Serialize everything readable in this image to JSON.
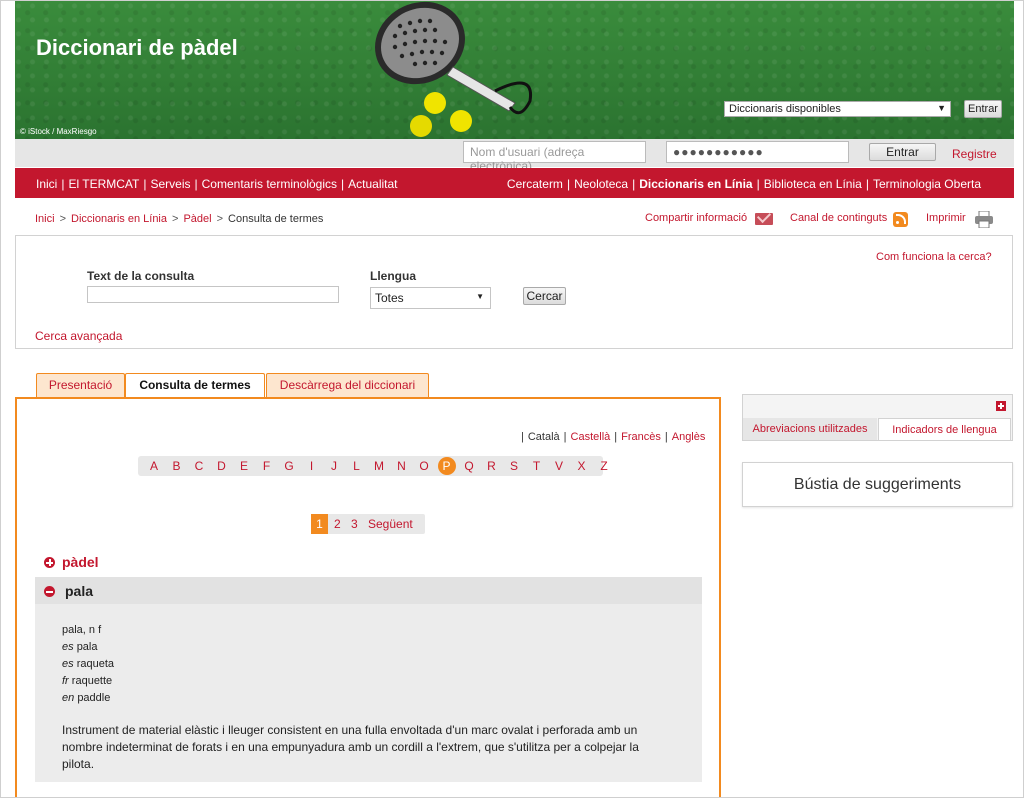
{
  "banner": {
    "title": "Diccionari de pàdel",
    "credit": "© iStock / MaxRiesgo",
    "dictionaries_select": "Diccionaris disponibles",
    "enter_button": "Entrar"
  },
  "login": {
    "user_placeholder": "Nom d'usuari (adreça electrònica)",
    "password_value": "●●●●●●●●●●●",
    "enter_button": "Entrar",
    "register_link": "Registre"
  },
  "nav": {
    "left": [
      "Inici",
      "El TERMCAT",
      "Serveis",
      "Comentaris terminològics",
      "Actualitat"
    ],
    "right": [
      "Cercaterm",
      "Neoloteca",
      "Diccionaris en Línia",
      "Biblioteca en Línia",
      "Terminologia Oberta"
    ]
  },
  "breadcrumb": [
    "Inici",
    "Diccionaris en Línia",
    "Pàdel",
    "Consulta de termes"
  ],
  "tools": {
    "share": "Compartir informació",
    "feed": "Canal de continguts",
    "print": "Imprimir"
  },
  "search": {
    "help_link": "Com funciona la cerca?",
    "query_label": "Text de la consulta",
    "language_label": "Llengua",
    "language_value": "Totes",
    "search_button": "Cercar",
    "advanced_link": "Cerca avançada"
  },
  "tabs": [
    "Presentació",
    "Consulta de termes",
    "Descàrrega del diccionari"
  ],
  "language_links": [
    "Català",
    "Castellà",
    "Francès",
    "Anglès"
  ],
  "alphabet": [
    "A",
    "B",
    "C",
    "D",
    "E",
    "F",
    "G",
    "I",
    "J",
    "L",
    "M",
    "N",
    "O",
    "P",
    "Q",
    "R",
    "S",
    "T",
    "V",
    "X",
    "Z"
  ],
  "active_letter": "P",
  "pager": {
    "current": "1",
    "pages": [
      "2",
      "3"
    ],
    "next": "Següent"
  },
  "terms": {
    "collapsed": "pàdel",
    "expanded": "pala",
    "entry": {
      "main": "pala, n f",
      "translations": [
        {
          "lang": "es",
          "term": "pala"
        },
        {
          "lang": "es",
          "term": "raqueta"
        },
        {
          "lang": "fr",
          "term": "raquette"
        },
        {
          "lang": "en",
          "term": "paddle"
        }
      ],
      "definition": "Instrument de material elàstic i lleuger consistent en una fulla envoltada d'un marc ovalat i perforada amb un nombre indeterminat de forats i en una empunyadura amb un cordill a l'extrem, que s'utilitza per a colpejar la pilota."
    }
  },
  "sidebar": {
    "tabs": [
      "Abreviacions utilitzades",
      "Indicadors de llengua"
    ],
    "suggestions": "Bústia de suggeriments"
  },
  "colors": {
    "brand_red": "#c3172e",
    "accent_orange": "#f28a1f"
  }
}
